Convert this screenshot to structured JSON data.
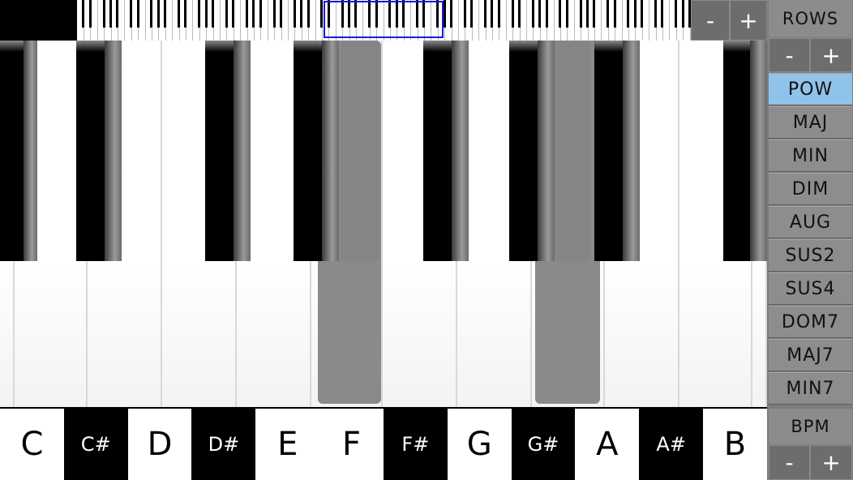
{
  "top": {
    "zoom_minus": "-",
    "zoom_plus": "+"
  },
  "panel": {
    "rows_label": "ROWS",
    "rows_minus": "-",
    "rows_plus": "+",
    "chords": [
      "POW",
      "MAJ",
      "MIN",
      "DIM",
      "AUG",
      "SUS2",
      "SUS4",
      "DOM7",
      "MAJ7",
      "MIN7"
    ],
    "active_chord": "POW",
    "bpm_label": "BPM",
    "bpm_minus": "-",
    "bpm_plus": "+"
  },
  "notes": [
    "C",
    "C#",
    "D",
    "D#",
    "E",
    "F",
    "F#",
    "G",
    "G#",
    "A",
    "A#",
    "B"
  ],
  "colors": {
    "active_chord": "#8fc3ea",
    "panel": "#8c8c8c",
    "mini_window": "#1a1adc",
    "pressed_key": "#8a8a8a"
  }
}
